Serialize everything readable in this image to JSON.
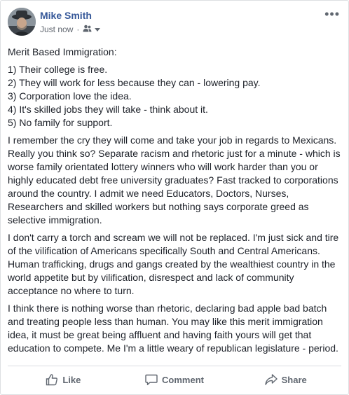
{
  "post": {
    "author": "Mike Smith",
    "timestamp": "Just now",
    "privacy_icon": "friends-icon",
    "more_label": "•••",
    "title": "Merit Based Immigration:",
    "list": [
      "1) Their college is free.",
      "2) They will work for less because they can - lowering pay.",
      "3) Corporation love the idea.",
      "4) It's skilled jobs they will take - think about it.",
      "5) No family for support."
    ],
    "paragraphs": [
      "I remember the cry they will come and take your job in regards to Mexicans. Really you think so? Separate racism and rhetoric just for a minute - which is worse family orientated lottery winners who will work harder than you or highly educated debt free university graduates? Fast tracked to corporations around the country. I admit we need Educators, Doctors, Nurses, Researchers and skilled workers but nothing says corporate greed as selective immigration.",
      "I don't carry a torch and scream we will not be replaced. I'm just sick and tire of the vilification of Americans specifically South and Central Americans. Human trafficking, drugs and gangs created by the wealthiest country in the world appetite but by vilification, disrespect and lack of community acceptance no where to turn.",
      "I think there is nothing worse than rhetoric, declaring bad apple bad batch and treating people less than human. You may like this merit immigration idea, it must be great being affluent and having faith yours will get that education to compete. Me I'm a little weary of republican legislature - period."
    ]
  },
  "actions": {
    "like": "Like",
    "comment": "Comment",
    "share": "Share"
  },
  "colors": {
    "author_link": "#365899",
    "meta_text": "#616770",
    "action_text": "#606770",
    "divider": "#dadde1"
  }
}
